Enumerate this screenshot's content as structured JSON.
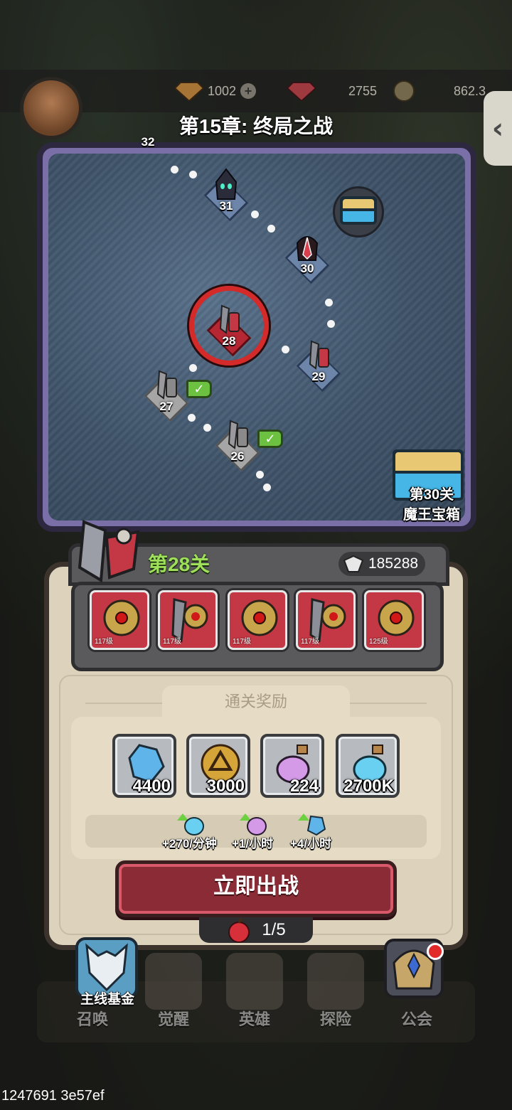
{
  "currency": {
    "gold_amount": "1002",
    "gem_amount": "2755",
    "coin_amount": "862.3"
  },
  "chapter_title": "第15章: 终局之战",
  "map": {
    "nodes": [
      {
        "num": "32",
        "state": "future"
      },
      {
        "num": "31",
        "state": "boss"
      },
      {
        "num": "30",
        "state": "boss"
      },
      {
        "num": "29",
        "state": "future"
      },
      {
        "num": "28",
        "state": "current"
      },
      {
        "num": "27",
        "state": "done"
      },
      {
        "num": "26",
        "state": "done"
      }
    ],
    "chest_label_line1": "第30关",
    "chest_label_line2": "魔王宝箱"
  },
  "stage": {
    "title": "第28关",
    "power": "185288",
    "enemies": [
      {
        "level": "117级",
        "type": "shield"
      },
      {
        "level": "117级",
        "type": "axe"
      },
      {
        "level": "117级",
        "type": "shield"
      },
      {
        "level": "117级",
        "type": "axe"
      },
      {
        "level": "125级",
        "type": "shield"
      }
    ]
  },
  "rewards": {
    "title": "通关奖励",
    "items": [
      {
        "icon": "crystal-icon",
        "amount": "4400"
      },
      {
        "icon": "gold-coin-icon",
        "amount": "3000"
      },
      {
        "icon": "purple-potion-icon",
        "amount": "224"
      },
      {
        "icon": "blue-potion-icon",
        "amount": "2700K"
      }
    ],
    "rates": [
      {
        "icon": "blue-potion-icon",
        "text": "+270/分钟"
      },
      {
        "icon": "purple-potion-icon",
        "text": "+1/小时"
      },
      {
        "icon": "crystal-icon",
        "text": "+4/小时"
      }
    ]
  },
  "fight_button": "立即出战",
  "stamina": "1/5",
  "nav": {
    "fund_label": "主线基金",
    "items": [
      "召唤",
      "觉醒",
      "英雄",
      "探险",
      "公会"
    ]
  },
  "footer_id": "1247691 3e57ef",
  "colors": {
    "accent_green": "#9fe05a",
    "fight_red": "#8a2b36",
    "map_purple": "#7a6fa6"
  }
}
